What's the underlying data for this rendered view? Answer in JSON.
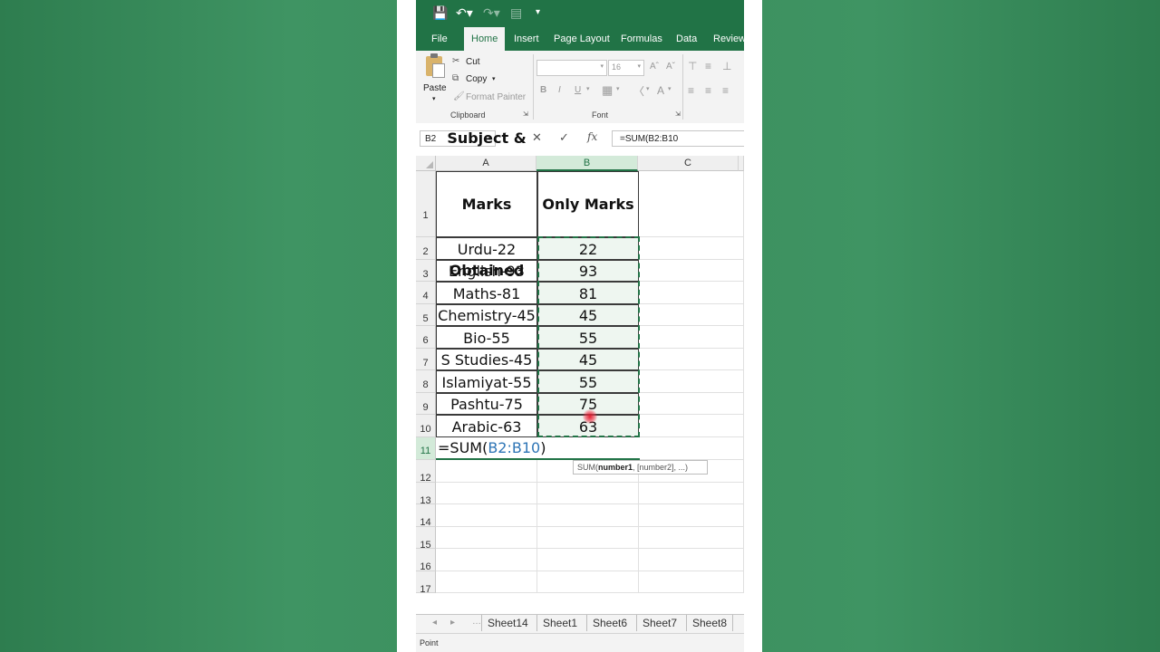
{
  "ribbon": {
    "tabs": [
      "File",
      "Home",
      "Insert",
      "Page Layout",
      "Formulas",
      "Data",
      "Review"
    ],
    "active_tab": "Home",
    "clipboard": {
      "paste": "Paste",
      "cut": "Cut",
      "copy": "Copy",
      "format_painter": "Format Painter",
      "group_label": "Clipboard"
    },
    "font": {
      "size": "16",
      "group_label": "Font",
      "bold": "B",
      "italic": "I",
      "underline": "U"
    }
  },
  "formula_bar": {
    "name_box": "B2",
    "formula": "=SUM(B2:B10",
    "fx": "fx"
  },
  "columns": [
    "A",
    "B",
    "C"
  ],
  "rows": [
    {
      "num": "1",
      "a": "Subject & Marks Obtained",
      "b": "Only Marks"
    },
    {
      "num": "2",
      "a": "Urdu-22",
      "b": "22"
    },
    {
      "num": "3",
      "a": "English-93",
      "b": "93"
    },
    {
      "num": "4",
      "a": "Maths-81",
      "b": "81"
    },
    {
      "num": "5",
      "a": "Chemistry-45",
      "b": "45"
    },
    {
      "num": "6",
      "a": "Bio-55",
      "b": "55"
    },
    {
      "num": "7",
      "a": "S Studies-45",
      "b": "45"
    },
    {
      "num": "8",
      "a": "Islamiyat-55",
      "b": "55"
    },
    {
      "num": "9",
      "a": "Pashtu-75",
      "b": "75"
    },
    {
      "num": "10",
      "a": "Arabic-63",
      "b": "63"
    }
  ],
  "header_lines": [
    "Subject &",
    "Marks",
    "Obtained"
  ],
  "edit_cell": {
    "row": "11",
    "prefix": "=SUM(",
    "ref": "B2:B10",
    "suffix": ")"
  },
  "tooltip": {
    "fn": "SUM(",
    "arg1": "number1",
    "rest": ", [number2], ...)"
  },
  "empty_rows": [
    "12",
    "13",
    "14",
    "15",
    "16",
    "17"
  ],
  "sheets": [
    "Sheet14",
    "Sheet1",
    "Sheet6",
    "Sheet7",
    "Sheet8"
  ],
  "status": "Point",
  "colors": {
    "excel_green": "#217346",
    "ref_blue": "#2e75b6"
  }
}
